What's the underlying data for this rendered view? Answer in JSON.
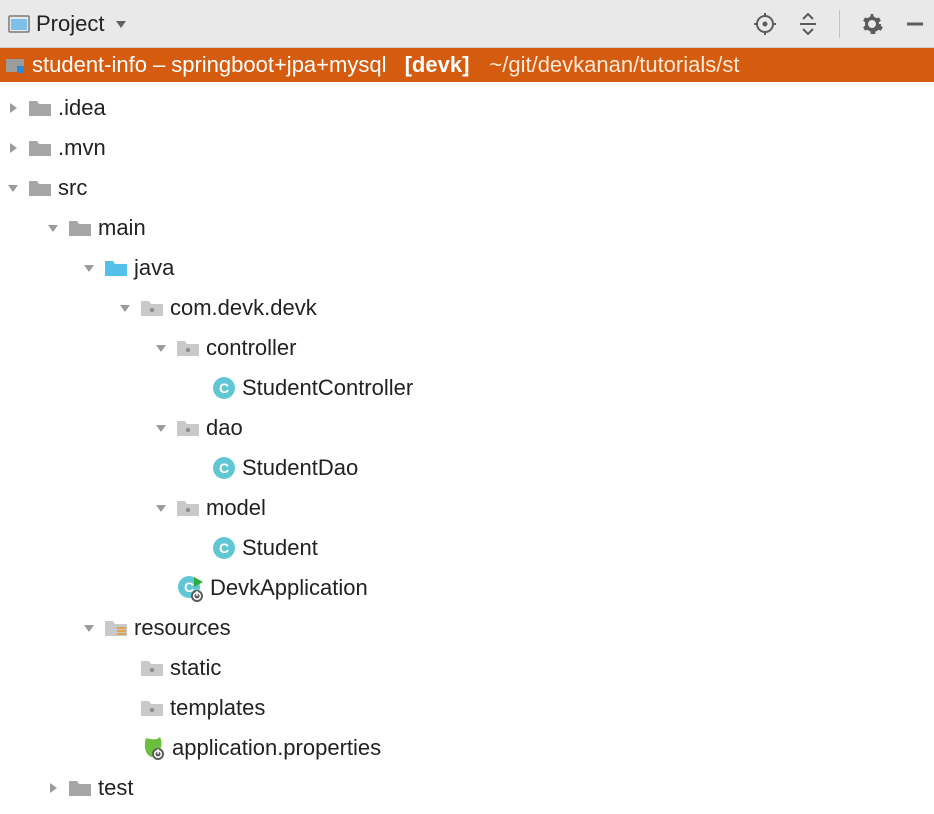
{
  "header": {
    "title": "Project"
  },
  "root": {
    "name": "student-info",
    "separator": " – ",
    "subtitle": "springboot+jpa+mysql",
    "tag": "[devk]",
    "path": "~/git/devkanan/tutorials/st"
  },
  "tree": {
    "idea": ".idea",
    "mvn": ".mvn",
    "src": "src",
    "main": "main",
    "java": "java",
    "pkg": "com.devk.devk",
    "controller": "controller",
    "studentController": "StudentController",
    "dao": "dao",
    "studentDao": "StudentDao",
    "model": "model",
    "student": "Student",
    "devkApplication": "DevkApplication",
    "resources": "resources",
    "static": "static",
    "templates": "templates",
    "appProps": "application.properties",
    "test": "test"
  }
}
